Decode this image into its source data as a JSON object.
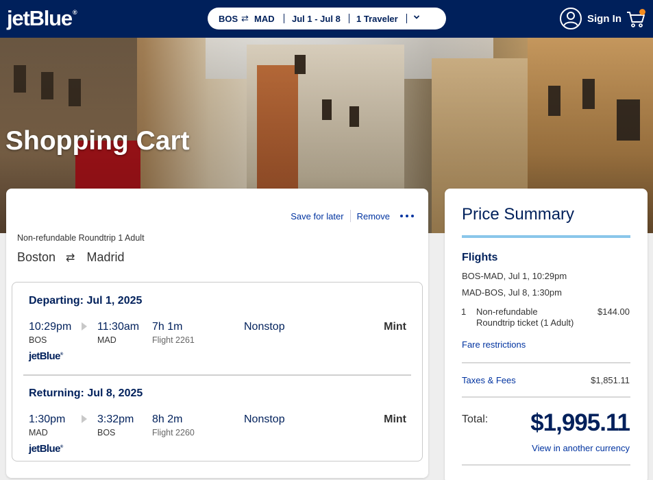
{
  "header": {
    "logo": "jetBlue",
    "logo_tm": "®",
    "search": {
      "origin": "BOS",
      "swap_symbol": "⇄",
      "destination": "MAD",
      "dates": "Jul 1 - Jul 8",
      "travelers": "1 Traveler"
    },
    "sign_in_label": "Sign In"
  },
  "hero": {
    "title": "Shopping Cart"
  },
  "cart": {
    "actions": {
      "save_label": "Save for later",
      "remove_label": "Remove"
    },
    "fare_type": "Non-refundable Roundtrip 1 Adult",
    "route": {
      "from": "Boston",
      "swap_symbol": "⇄",
      "to": "Madrid"
    },
    "segments": [
      {
        "title": "Departing: Jul 1, 2025",
        "depart_time": "10:29pm",
        "depart_code": "BOS",
        "arrive_time": "11:30am",
        "arrive_code": "MAD",
        "duration": "7h 1m",
        "flight": "Flight 2261",
        "stops": "Nonstop",
        "cabin": "Mint",
        "airline_logo": "jetBlue"
      },
      {
        "title": "Returning: Jul 8, 2025",
        "depart_time": "1:30pm",
        "depart_code": "MAD",
        "arrive_time": "3:32pm",
        "arrive_code": "BOS",
        "duration": "8h 2m",
        "flight": "Flight 2260",
        "stops": "Nonstop",
        "cabin": "Mint",
        "airline_logo": "jetBlue"
      }
    ]
  },
  "price_summary": {
    "title": "Price Summary",
    "flights_heading": "Flights",
    "legs": [
      "BOS-MAD, Jul 1, 10:29pm",
      "MAD-BOS, Jul 8, 1:30pm"
    ],
    "line_item": {
      "qty": "1",
      "desc_line1": "Non-refundable",
      "desc_line2": "Roundtrip ticket (1 Adult)",
      "amount": "$144.00"
    },
    "fare_restrictions_label": "Fare restrictions",
    "taxes_label": "Taxes & Fees",
    "taxes_amount": "$1,851.11",
    "total_label": "Total:",
    "total_amount": "$1,995.11",
    "currency_link": "View in another currency"
  },
  "colors": {
    "brand_navy": "#00205b",
    "link_blue": "#0033a0",
    "accent_sky": "#8ac6ea",
    "cart_badge_orange": "#f68c1f"
  }
}
